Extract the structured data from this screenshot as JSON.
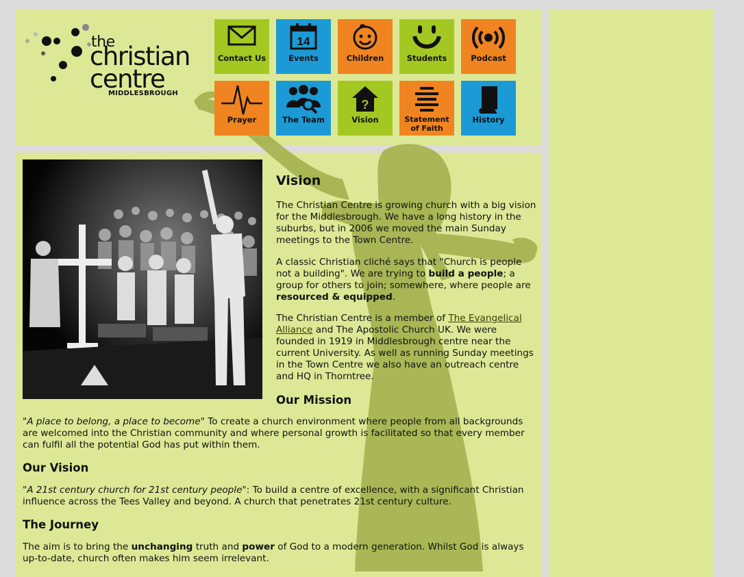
{
  "logo": {
    "the": "the",
    "christian": "christian",
    "centre": "centre",
    "city": "MIDDLESBROUGH"
  },
  "nav": [
    {
      "label": "Contact Us",
      "icon": "envelope-icon",
      "color": "#a4c822"
    },
    {
      "label": "Events",
      "icon": "calendar-icon",
      "color": "#1c9ad6",
      "icon_text": "14"
    },
    {
      "label": "Children",
      "icon": "child-face-icon",
      "color": "#ef8420"
    },
    {
      "label": "Students",
      "icon": "smile-icon",
      "color": "#a4c822"
    },
    {
      "label": "Podcast",
      "icon": "broadcast-icon",
      "color": "#ef8420"
    },
    {
      "label": "Prayer",
      "icon": "heartbeat-icon",
      "color": "#ef8420"
    },
    {
      "label": "The Team",
      "icon": "team-icon",
      "color": "#1c9ad6"
    },
    {
      "label": "Vision",
      "icon": "house-question-icon",
      "color": "#a4c822"
    },
    {
      "label": "Statement of Faith",
      "icon": "lines-icon",
      "color": "#ef8420"
    },
    {
      "label": "History",
      "icon": "book-icon",
      "color": "#1c9ad6"
    }
  ],
  "content": {
    "title": "Vision",
    "p1": "The Christian Centre is growing church with a big vision for the Middlesbrough. We have a long history in the suburbs, but in 2006 we moved the main Sunday meetings to the Town Centre.",
    "p2_a": "A classic Christian cliché says that \"Church is people not a building\". We are trying to ",
    "p2_b": "build a people",
    "p2_c": "; a group for others to join; somewhere, where people are ",
    "p2_d": "resourced & equipped",
    "p2_e": ".",
    "p3_a": "The Christian Centre is a member of ",
    "p3_link": "The Evangelical Alliance",
    "p3_b": " and The Apostolic Church UK. We were founded in 1919 in Middlesbrough centre near the current University. As well as running Sunday meetings in the Town Centre we also have an outreach centre and HQ in Thorntree.",
    "mission_heading": "Our Mission",
    "mission_quote": "\"A place to belong, a place to become\"",
    "mission_text": " To create a church environment where people from all backgrounds are welcomed into the Christian community and where personal growth is facilitated so that every member can fulfil all the potential God has put within them.",
    "vision_heading": "Our Vision",
    "vision_quote": "\"A 21st century church for 21st century people\"",
    "vision_text": ": To build a centre of excellence, with a significant Christian influence across the Tees Valley and beyond. A church that penetrates 21st century culture.",
    "journey_heading": "The Journey",
    "journey_a": "The aim is to bring the ",
    "journey_b": "unchanging",
    "journey_c": " truth and ",
    "journey_d": "power",
    "journey_e": " of God to a modern generation. Whilst God is always up-to-date, church often makes him seem irrelevant."
  },
  "colors": {
    "background": "#dcdcdc",
    "panel": "#dde896",
    "green": "#a4c822",
    "blue": "#1c9ad6",
    "orange": "#ef8420",
    "silhouette": "#a7b452"
  }
}
